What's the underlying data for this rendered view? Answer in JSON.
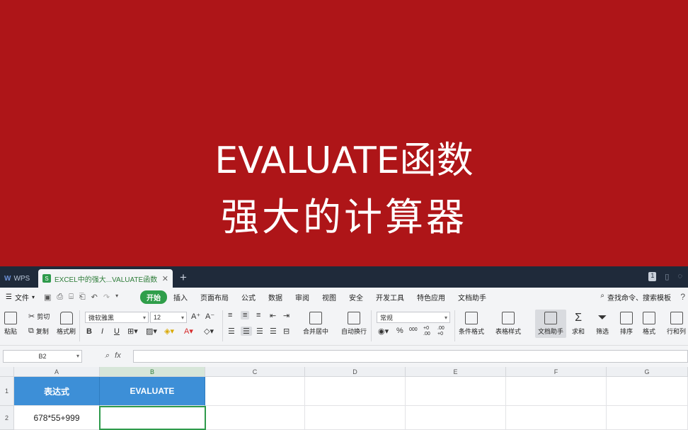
{
  "banner": {
    "line1": "EVALUATE函数",
    "line2": "强大的计算器",
    "color": "#ae1518"
  },
  "tabbar": {
    "wps_label": "WPS",
    "doc_tab_label": "EXCEL中的强大...VALUATE函数",
    "close_glyph": "✕",
    "add_glyph": "+",
    "window_count": "1"
  },
  "menubar": {
    "file_label": "文件",
    "items": [
      "开始",
      "插入",
      "页面布局",
      "公式",
      "数据",
      "审阅",
      "视图",
      "安全",
      "开发工具",
      "特色应用",
      "文档助手"
    ],
    "active_item": "开始",
    "search_label": "查找命令、搜索模板",
    "help": "?"
  },
  "ribbon": {
    "paste": "粘贴",
    "cut": "剪切",
    "copy": "复制",
    "format_painter": "格式刷",
    "font_name": "微软雅黑",
    "font_size": "12",
    "bold": "B",
    "italic": "I",
    "underline": "U",
    "merge_center": "合并居中",
    "wrap_text": "自动换行",
    "number_format": "常规",
    "percent": "%",
    "thousands": "000",
    "inc_decimal": "+0 .00",
    "dec_decimal": ".00 +0",
    "conditional_format": "条件格式",
    "table_style": "表格样式",
    "doc_assistant": "文档助手",
    "sum": "求和",
    "filter": "筛选",
    "sort": "排序",
    "format": "格式",
    "row_col": "行和列"
  },
  "formula_bar": {
    "name_box": "B2",
    "fx_label": "fx",
    "formula": ""
  },
  "sheet": {
    "columns": [
      "A",
      "B",
      "C",
      "D",
      "E",
      "F",
      "G"
    ],
    "rows": [
      "1",
      "2"
    ],
    "cells": {
      "A1": "表达式",
      "B1": "EVALUATE",
      "A2": "678*55+999",
      "B2": ""
    },
    "header_fill": "#3d8fd7",
    "active_border": "#2e9a4b"
  }
}
